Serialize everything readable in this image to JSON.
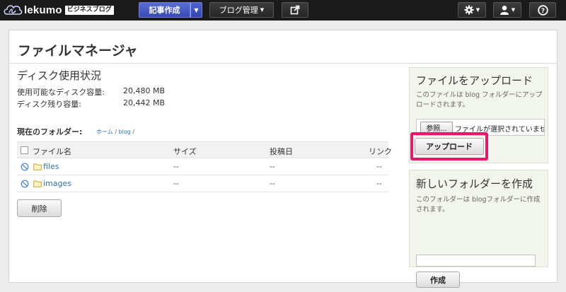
{
  "topbar": {
    "brand": "lekumo",
    "brand_badge": "ビジネスブログ",
    "write_label": "記事作成",
    "blog_manage_label": "ブログ管理",
    "icons": [
      "external-link-icon",
      "gear-icon",
      "user-icon",
      "help-icon"
    ]
  },
  "page": {
    "title": "ファイルマネージャ"
  },
  "disk": {
    "heading": "ディスク使用状況",
    "rows": [
      {
        "label": "使用可能なディスク容量:",
        "value": "20,480 MB"
      },
      {
        "label": "ディスク残り容量:",
        "value": "20,442 MB"
      }
    ]
  },
  "folder": {
    "label": "現在のフォルダー:",
    "crumb_home": "ホーム",
    "crumb_sep": "/",
    "crumb_blog": "blog",
    "crumb_end": "/"
  },
  "table": {
    "headers": {
      "name": "ファイル名",
      "size": "サイズ",
      "date": "投稿日",
      "link": "リンク"
    },
    "rows": [
      {
        "name": "files",
        "size": "--",
        "date": "--",
        "link": "--"
      },
      {
        "name": "images",
        "size": "--",
        "date": "--",
        "link": "--"
      }
    ]
  },
  "delete_label": "削除",
  "upload": {
    "title": "ファイルをアップロード",
    "desc": "このファイルは blog フォルダーにアップロードされます。",
    "browse_label": "参照...",
    "file_status": "ファイルが選択されていません。",
    "button_label": "アップロード"
  },
  "new_folder": {
    "title": "新しいフォルダーを作成",
    "desc": "このフォルダーは blogフォルダーに作成されます。",
    "input_value": "",
    "button_label": "作成"
  },
  "colors": {
    "topbar": "#1b1b1b",
    "accent_blue": "#3848b8",
    "link": "#2a72b8",
    "highlight": "#e6186a",
    "sidebox": "#f2f5ec"
  }
}
